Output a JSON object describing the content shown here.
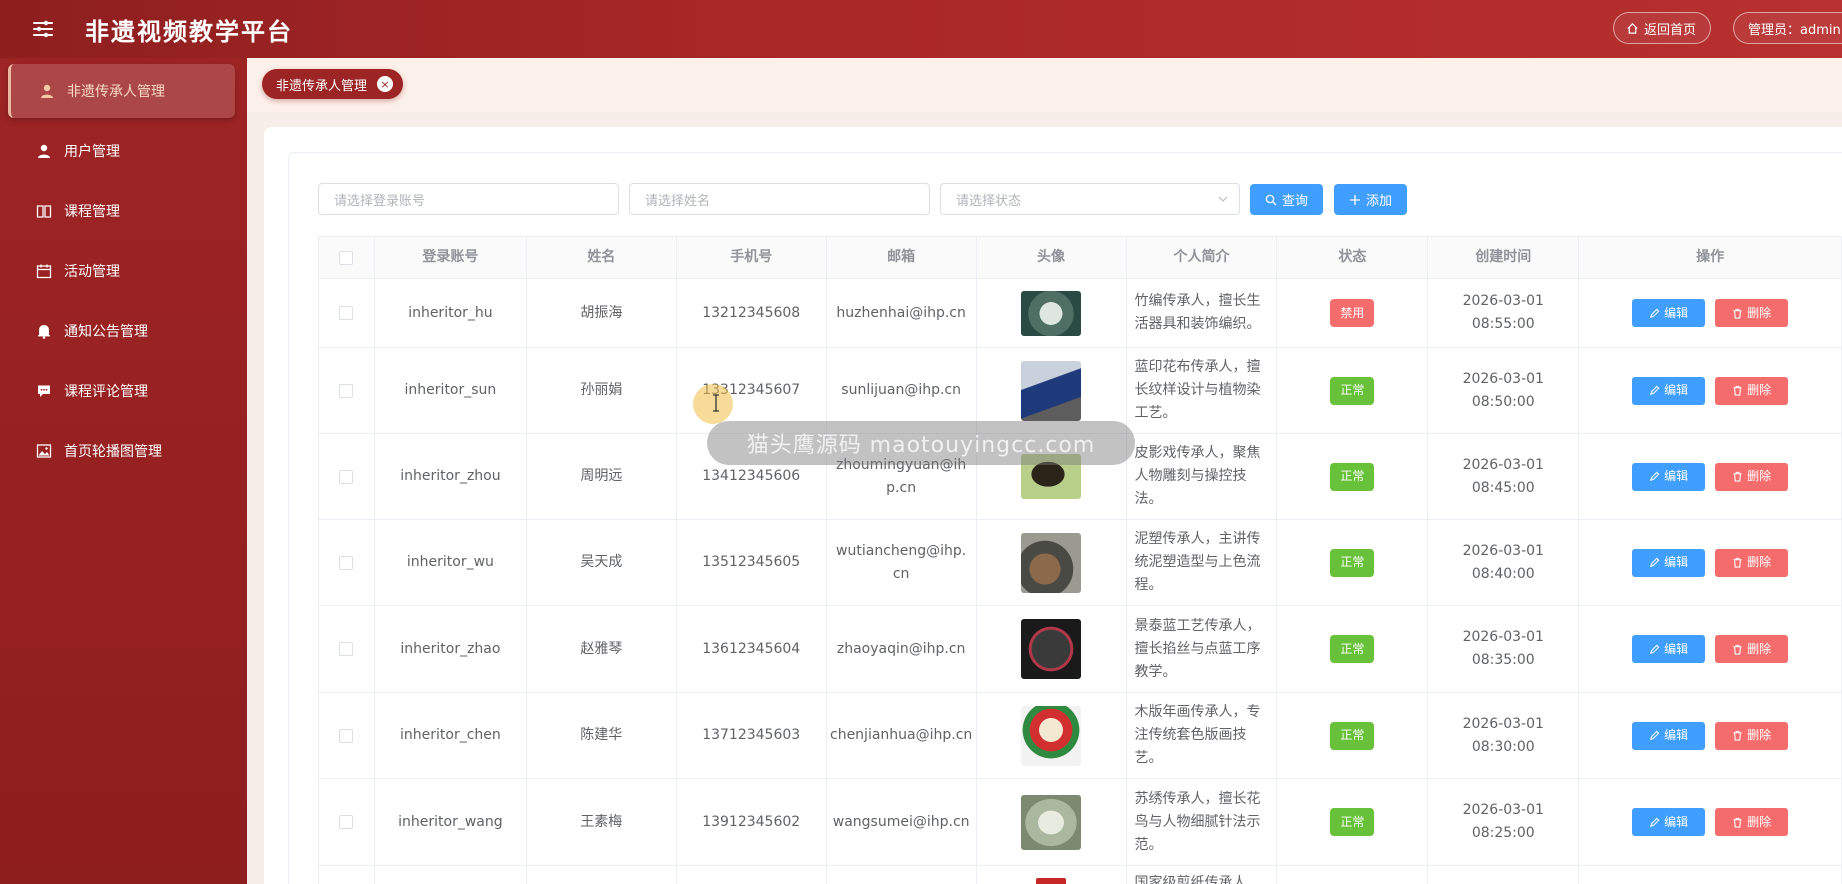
{
  "app": {
    "title": "非遗视频教学平台"
  },
  "header": {
    "home_label": "返回首页",
    "admin_label": "管理员：admin"
  },
  "sidebar": {
    "items": [
      {
        "label": "非遗传承人管理",
        "icon": "user-icon",
        "active": true
      },
      {
        "label": "用户管理",
        "icon": "user-icon",
        "active": false
      },
      {
        "label": "课程管理",
        "icon": "book-icon",
        "active": false
      },
      {
        "label": "活动管理",
        "icon": "calendar-icon",
        "active": false
      },
      {
        "label": "通知公告管理",
        "icon": "bell-icon",
        "active": false
      },
      {
        "label": "课程评论管理",
        "icon": "comment-icon",
        "active": false
      },
      {
        "label": "首页轮播图管理",
        "icon": "image-icon",
        "active": false
      }
    ]
  },
  "tabs": [
    {
      "label": "非遗传承人管理",
      "close": "×"
    }
  ],
  "search": {
    "account_placeholder": "请选择登录账号",
    "name_placeholder": "请选择姓名",
    "status_placeholder": "请选择状态",
    "query_label": "查询",
    "add_label": "添加"
  },
  "table": {
    "headers": [
      "登录账号",
      "姓名",
      "手机号",
      "邮箱",
      "头像",
      "个人简介",
      "状态",
      "创建时间",
      "操作"
    ],
    "edit_label": "编辑",
    "delete_label": "删除",
    "rows": [
      {
        "account": "inheritor_hu",
        "name": "胡振海",
        "phone": "13212345608",
        "email": "huzhenhai@ihp.cn",
        "intro": "竹编传承人，擅长生活器具和装饰编织。",
        "status": "禁用",
        "created": "2026-03-01 08:55:00"
      },
      {
        "account": "inheritor_sun",
        "name": "孙丽娟",
        "phone": "13312345607",
        "email": "sunlijuan@ihp.cn",
        "intro": "蓝印花布传承人，擅长纹样设计与植物染工艺。",
        "status": "正常",
        "created": "2026-03-01 08:50:00"
      },
      {
        "account": "inheritor_zhou",
        "name": "周明远",
        "phone": "13412345606",
        "email": "zhoumingyuan@ihp.cn",
        "intro": "皮影戏传承人，聚焦人物雕刻与操控技法。",
        "status": "正常",
        "created": "2026-03-01 08:45:00"
      },
      {
        "account": "inheritor_wu",
        "name": "吴天成",
        "phone": "13512345605",
        "email": "wutiancheng@ihp.cn",
        "intro": "泥塑传承人，主讲传统泥塑造型与上色流程。",
        "status": "正常",
        "created": "2026-03-01 08:40:00"
      },
      {
        "account": "inheritor_zhao",
        "name": "赵雅琴",
        "phone": "13612345604",
        "email": "zhaoyaqin@ihp.cn",
        "intro": "景泰蓝工艺传承人，擅长掐丝与点蓝工序教学。",
        "status": "正常",
        "created": "2026-03-01 08:35:00"
      },
      {
        "account": "inheritor_chen",
        "name": "陈建华",
        "phone": "13712345603",
        "email": "chenjianhua@ihp.cn",
        "intro": "木版年画传承人，专注传统套色版画技艺。",
        "status": "正常",
        "created": "2026-03-01 08:30:00"
      },
      {
        "account": "inheritor_wang",
        "name": "王素梅",
        "phone": "13912345602",
        "email": "wangsumei@ihp.cn",
        "intro": "苏绣传承人，擅长花鸟与人物细腻针法示范。",
        "status": "正常",
        "created": "2026-03-01 08:25:00"
      },
      {
        "account": "",
        "name": "",
        "phone": "",
        "email": "",
        "intro": "国家级剪纸传承人",
        "status": "",
        "created": ""
      }
    ]
  },
  "watermark": {
    "text": "猫头鹰源码 maotouyingcc.com"
  },
  "colors": {
    "primary": "#409eff",
    "danger": "#f56c6c",
    "success": "#67c23a",
    "brand": "#9c2424"
  }
}
